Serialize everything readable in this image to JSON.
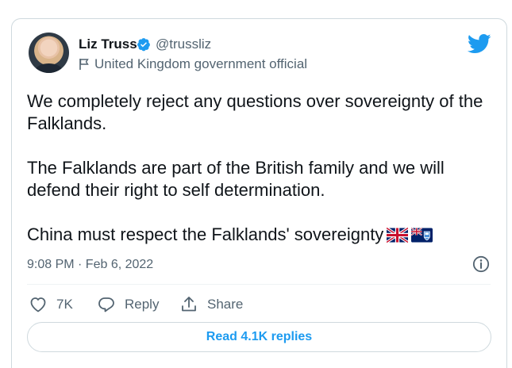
{
  "author": {
    "name": "Liz Truss",
    "handle": "@trussliz",
    "label": "United Kingdom government official",
    "avatar_icon": "profile-photo",
    "verified_color": "#1d9bf0"
  },
  "tweet": {
    "paragraphs": [
      "We completely reject any questions over sovereignty of the Falklands.",
      "The Falklands are part of the British family and we will defend their right to self determination.",
      "China must respect the Falklands' sovereignty"
    ],
    "emojis": [
      "uk-flag",
      "falklands-flag"
    ],
    "timestamp": "9:08 PM · Feb 6, 2022"
  },
  "actions": {
    "like_count": "7K",
    "reply_label": "Reply",
    "share_label": "Share"
  },
  "read_replies_label": "Read 4.1K replies",
  "colors": {
    "accent": "#1d9bf0",
    "muted": "#536471",
    "border": "#cfd9de"
  }
}
